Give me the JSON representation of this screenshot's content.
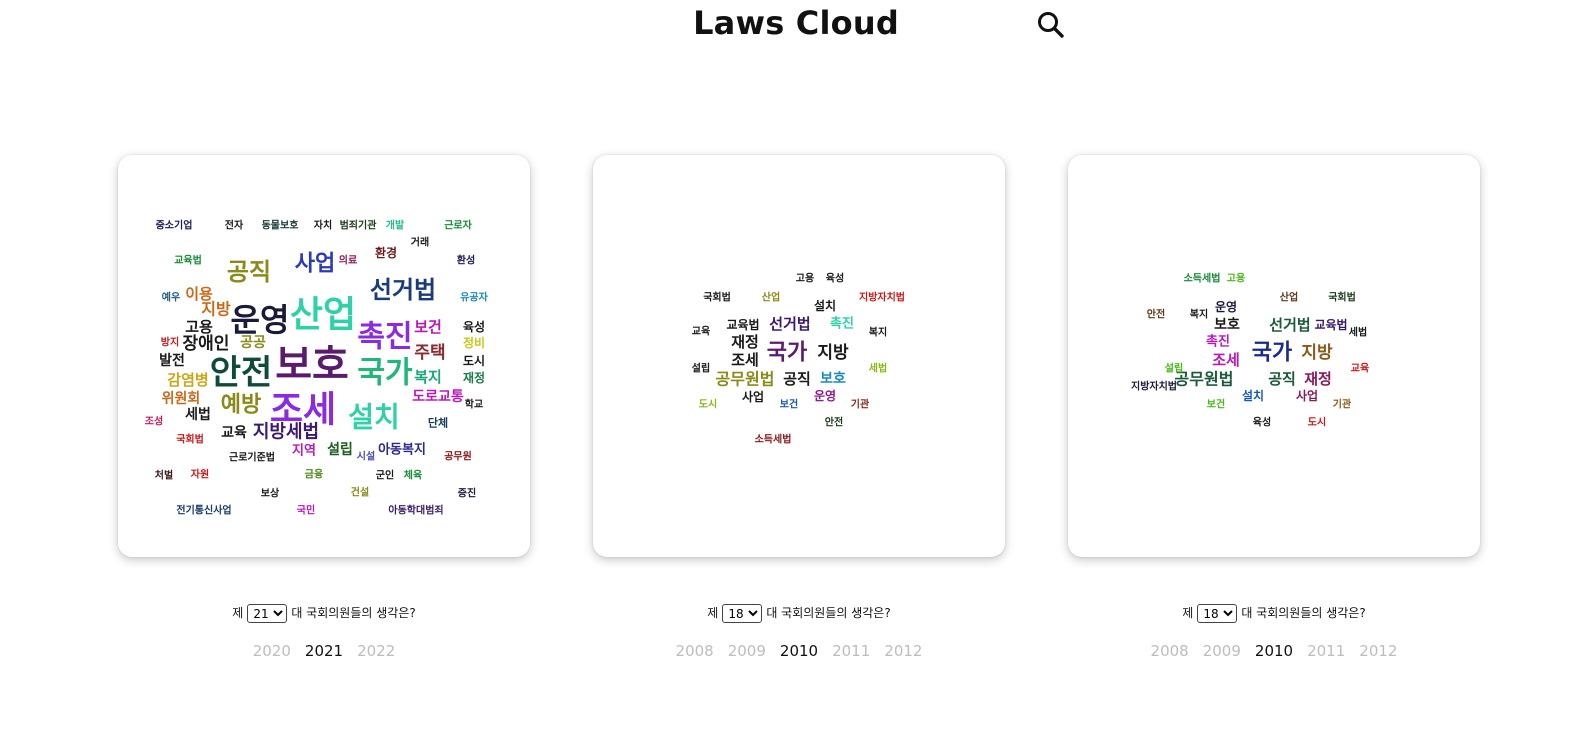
{
  "header": {
    "title": "Laws Cloud",
    "search_icon": "search-icon"
  },
  "panels": [
    {
      "session_prefix": "제",
      "session_value": "21",
      "session_suffix": "대 국회의원들의 생각은?",
      "years": [
        "2020",
        "2021",
        "2022"
      ],
      "active_year": "2021",
      "words": [
        {
          "text": "보호",
          "size": 40,
          "color": "#5a1a6e"
        },
        {
          "text": "조세",
          "size": 36,
          "color": "#8a2be2"
        },
        {
          "text": "산업",
          "size": 36,
          "color": "#2fd1a8"
        },
        {
          "text": "안전",
          "size": 34,
          "color": "#0f4a3a"
        },
        {
          "text": "운영",
          "size": 32,
          "color": "#1a1a3a"
        },
        {
          "text": "촉진",
          "size": 30,
          "color": "#8a2be2"
        },
        {
          "text": "국가",
          "size": 30,
          "color": "#1fb87a"
        },
        {
          "text": "설치",
          "size": 28,
          "color": "#2fd1a8"
        },
        {
          "text": "선거법",
          "size": 24,
          "color": "#1a3a7a"
        },
        {
          "text": "공직",
          "size": 24,
          "color": "#8a8a1a"
        },
        {
          "text": "사업",
          "size": 22,
          "color": "#2a3ab8"
        },
        {
          "text": "예방",
          "size": 22,
          "color": "#8a8a1a"
        },
        {
          "text": "지방세법",
          "size": 18,
          "color": "#3a1a6e"
        },
        {
          "text": "장애인",
          "size": 17,
          "color": "#1a1a1a"
        },
        {
          "text": "주택",
          "size": 17,
          "color": "#8a2a2a"
        },
        {
          "text": "보건",
          "size": 15,
          "color": "#b81ab8"
        },
        {
          "text": "복지",
          "size": 15,
          "color": "#1aa87a"
        },
        {
          "text": "도로교통",
          "size": 14,
          "color": "#b81ab8"
        },
        {
          "text": "감염병",
          "size": 15,
          "color": "#c8a81a"
        },
        {
          "text": "위원회",
          "size": 14,
          "color": "#c86a1a"
        },
        {
          "text": "지방",
          "size": 16,
          "color": "#c86a1a"
        },
        {
          "text": "이용",
          "size": 15,
          "color": "#c86a1a"
        },
        {
          "text": "고용",
          "size": 15,
          "color": "#1a1a1a"
        },
        {
          "text": "공공",
          "size": 14,
          "color": "#8a8a1a"
        },
        {
          "text": "발전",
          "size": 14,
          "color": "#1a1a1a"
        },
        {
          "text": "세법",
          "size": 14,
          "color": "#1a1a1a"
        },
        {
          "text": "교육",
          "size": 14,
          "color": "#1a1a1a"
        },
        {
          "text": "지역",
          "size": 13,
          "color": "#b81ab8"
        },
        {
          "text": "설립",
          "size": 14,
          "color": "#1a5a1a"
        },
        {
          "text": "아동복지",
          "size": 13,
          "color": "#2a2a8a"
        },
        {
          "text": "환경",
          "size": 12,
          "color": "#6a1a1a"
        },
        {
          "text": "육성",
          "size": 12,
          "color": "#1a1a1a"
        },
        {
          "text": "정비",
          "size": 12,
          "color": "#c8c81a"
        },
        {
          "text": "도시",
          "size": 12,
          "color": "#1a1a1a"
        },
        {
          "text": "재정",
          "size": 12,
          "color": "#1a7a4a"
        },
        {
          "text": "단체",
          "size": 11,
          "color": "#1a3a5a"
        },
        {
          "text": "근로기준법",
          "size": 10,
          "color": "#1a1a1a"
        },
        {
          "text": "시설",
          "size": 10,
          "color": "#4a4ab8"
        },
        {
          "text": "교육법",
          "size": 10,
          "color": "#1a8a3a"
        },
        {
          "text": "예우",
          "size": 10,
          "color": "#1a5a8a"
        },
        {
          "text": "방지",
          "size": 10,
          "color": "#c81a1a"
        },
        {
          "text": "조성",
          "size": 10,
          "color": "#c81a5a"
        },
        {
          "text": "국회법",
          "size": 10,
          "color": "#c81a1a"
        },
        {
          "text": "처벌",
          "size": 10,
          "color": "#3a1a1a"
        },
        {
          "text": "자원",
          "size": 10,
          "color": "#c81a1a"
        },
        {
          "text": "금융",
          "size": 10,
          "color": "#4a8a1a"
        },
        {
          "text": "군인",
          "size": 10,
          "color": "#1a1a1a"
        },
        {
          "text": "체육",
          "size": 10,
          "color": "#1a8a3a"
        },
        {
          "text": "공무원",
          "size": 10,
          "color": "#8a1a1a"
        },
        {
          "text": "보상",
          "size": 10,
          "color": "#1a1a1a"
        },
        {
          "text": "건설",
          "size": 10,
          "color": "#8a8a1a"
        },
        {
          "text": "증진",
          "size": 10,
          "color": "#1a1a3a"
        },
        {
          "text": "전기통신사업",
          "size": 10,
          "color": "#1a3a6a"
        },
        {
          "text": "국민",
          "size": 10,
          "color": "#b81ab8"
        },
        {
          "text": "아동학대범죄",
          "size": 10,
          "color": "#3a1a6a"
        },
        {
          "text": "중소기업",
          "size": 10,
          "color": "#1a1a5a"
        },
        {
          "text": "전자",
          "size": 10,
          "color": "#1a1a1a"
        },
        {
          "text": "동물보호",
          "size": 10,
          "color": "#1a3a3a"
        },
        {
          "text": "자치",
          "size": 10,
          "color": "#1a1a1a"
        },
        {
          "text": "범죄기관",
          "size": 10,
          "color": "#1a3a1a"
        },
        {
          "text": "개발",
          "size": 10,
          "color": "#2ab88a"
        },
        {
          "text": "근로자",
          "size": 10,
          "color": "#1a8a3a"
        },
        {
          "text": "거래",
          "size": 10,
          "color": "#1a1a1a"
        },
        {
          "text": "의료",
          "size": 10,
          "color": "#8a1a5a"
        },
        {
          "text": "환성",
          "size": 10,
          "color": "#1a1a5a"
        },
        {
          "text": "유공자",
          "size": 10,
          "color": "#1a8ab8"
        },
        {
          "text": "학교",
          "size": 10,
          "color": "#1a1a1a"
        }
      ]
    },
    {
      "session_prefix": "제",
      "session_value": "18",
      "session_suffix": "대 국회의원들의 생각은?",
      "years": [
        "2008",
        "2009",
        "2010",
        "2011",
        "2012"
      ],
      "active_year": "2010",
      "words": [
        {
          "text": "국가",
          "size": 22,
          "color": "#5a1a6e"
        },
        {
          "text": "지방",
          "size": 17,
          "color": "#1a1a1a"
        },
        {
          "text": "공무원법",
          "size": 16,
          "color": "#8a8a1a"
        },
        {
          "text": "공직",
          "size": 15,
          "color": "#1a1a1a"
        },
        {
          "text": "선거법",
          "size": 15,
          "color": "#3a1a6e"
        },
        {
          "text": "재정",
          "size": 15,
          "color": "#1a1a1a"
        },
        {
          "text": "조세",
          "size": 15,
          "color": "#1a1a1a"
        },
        {
          "text": "보호",
          "size": 14,
          "color": "#1a8ab8"
        },
        {
          "text": "교육법",
          "size": 12,
          "color": "#1a1a1a"
        },
        {
          "text": "촉진",
          "size": 13,
          "color": "#2fd1a8"
        },
        {
          "text": "설치",
          "size": 12,
          "color": "#1a1a1a"
        },
        {
          "text": "운영",
          "size": 12,
          "color": "#8a1a8a"
        },
        {
          "text": "사업",
          "size": 12,
          "color": "#1a1a1a"
        },
        {
          "text": "세법",
          "size": 10,
          "color": "#8ab81a"
        },
        {
          "text": "복지",
          "size": 10,
          "color": "#1a1a1a"
        },
        {
          "text": "교육",
          "size": 10,
          "color": "#1a1a1a"
        },
        {
          "text": "설립",
          "size": 10,
          "color": "#1a1a1a"
        },
        {
          "text": "도시",
          "size": 10,
          "color": "#8ab81a"
        },
        {
          "text": "보건",
          "size": 10,
          "color": "#1a5ab8"
        },
        {
          "text": "기관",
          "size": 10,
          "color": "#8a2a1a"
        },
        {
          "text": "안전",
          "size": 10,
          "color": "#1a3a1a"
        },
        {
          "text": "소득세법",
          "size": 10,
          "color": "#8a1a1a"
        },
        {
          "text": "국회법",
          "size": 10,
          "color": "#1a1a1a"
        },
        {
          "text": "산업",
          "size": 10,
          "color": "#8a8a1a"
        },
        {
          "text": "고용",
          "size": 10,
          "color": "#1a1a1a"
        },
        {
          "text": "육성",
          "size": 10,
          "color": "#1a1a1a"
        },
        {
          "text": "지방자치법",
          "size": 10,
          "color": "#c81a1a"
        }
      ]
    },
    {
      "session_prefix": "제",
      "session_value": "18",
      "session_suffix": "대 국회의원들의 생각은?",
      "years": [
        "2008",
        "2009",
        "2010",
        "2011",
        "2012"
      ],
      "active_year": "2010",
      "words": [
        {
          "text": "국가",
          "size": 22,
          "color": "#1a2a8a"
        },
        {
          "text": "지방",
          "size": 17,
          "color": "#8a5a1a"
        },
        {
          "text": "공무원법",
          "size": 16,
          "color": "#1a5a3a"
        },
        {
          "text": "공직",
          "size": 15,
          "color": "#1a5a3a"
        },
        {
          "text": "선거법",
          "size": 15,
          "color": "#1a5a3a"
        },
        {
          "text": "재정",
          "size": 15,
          "color": "#8a1a5a"
        },
        {
          "text": "조세",
          "size": 15,
          "color": "#b81ab8"
        },
        {
          "text": "보호",
          "size": 14,
          "color": "#1a1a1a"
        },
        {
          "text": "교육법",
          "size": 12,
          "color": "#3a1a6e"
        },
        {
          "text": "촉진",
          "size": 13,
          "color": "#b81ab8"
        },
        {
          "text": "설치",
          "size": 12,
          "color": "#1a5ab8"
        },
        {
          "text": "운영",
          "size": 12,
          "color": "#1a1a3a"
        },
        {
          "text": "사업",
          "size": 12,
          "color": "#8a1a5a"
        },
        {
          "text": "세법",
          "size": 10,
          "color": "#1a1a1a"
        },
        {
          "text": "교육",
          "size": 10,
          "color": "#c81a1a"
        },
        {
          "text": "설립",
          "size": 10,
          "color": "#4ab81a"
        },
        {
          "text": "복지",
          "size": 10,
          "color": "#1a1a1a"
        },
        {
          "text": "안전",
          "size": 10,
          "color": "#5a3a1a"
        },
        {
          "text": "지방자치법",
          "size": 10,
          "color": "#1a1a3a"
        },
        {
          "text": "보건",
          "size": 10,
          "color": "#4ab81a"
        },
        {
          "text": "기관",
          "size": 10,
          "color": "#8a5a1a"
        },
        {
          "text": "도시",
          "size": 10,
          "color": "#c81a1a"
        },
        {
          "text": "육성",
          "size": 10,
          "color": "#1a1a1a"
        },
        {
          "text": "산업",
          "size": 10,
          "color": "#5a3a1a"
        },
        {
          "text": "국회법",
          "size": 10,
          "color": "#1a3a1a"
        },
        {
          "text": "소득세법",
          "size": 10,
          "color": "#1a8a3a"
        },
        {
          "text": "고용",
          "size": 10,
          "color": "#4ab81a"
        }
      ]
    }
  ]
}
